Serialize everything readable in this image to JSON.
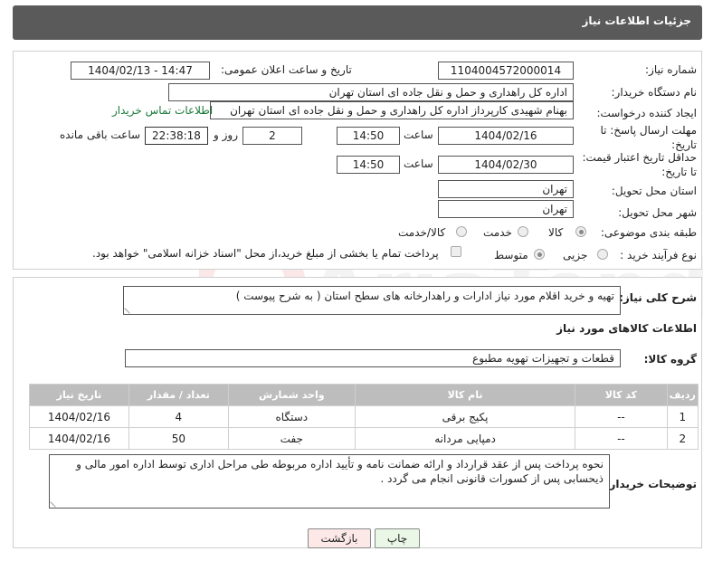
{
  "header": {
    "title": "جزئیات اطلاعات نیاز"
  },
  "fields": {
    "need_number_label": "شماره نیاز:",
    "need_number": "1104004572000014",
    "announce_label": "تاریخ و ساعت اعلان عمومی:",
    "announce_value": "1404/02/13 - 14:47",
    "buyer_org_label": "نام دستگاه خریدار:",
    "buyer_org": "اداره کل راهداری و حمل و نقل جاده ای استان تهران",
    "requester_label": "ایجاد کننده درخواست:",
    "requester": "بهنام شهیدی کارپرداز اداره کل راهداری و حمل و نقل جاده ای استان تهران",
    "buyer_contact_link": "اطلاعات تماس خریدار",
    "reply_deadline_label": "مهلت ارسال پاسخ: تا تاریخ:",
    "reply_date": "1404/02/16",
    "time_label": "ساعت",
    "reply_time": "14:50",
    "days_value": "2",
    "days_label": "روز و",
    "remaining_time": "22:38:18",
    "remaining_label": "ساعت باقی مانده",
    "price_validity_label": "حداقل تاریخ اعتبار قیمت: تا تاریخ:",
    "price_date": "1404/02/30",
    "price_time": "14:50",
    "province_label": "استان محل تحویل:",
    "province": "تهران",
    "city_label": "شهر محل تحویل:",
    "city": "تهران",
    "category_label": "طبقه بندی موضوعی:",
    "category_options": [
      "کالا",
      "خدمت",
      "کالا/خدمت"
    ],
    "process_label": "نوع فرآیند خرید :",
    "process_options": [
      "جزیی",
      "متوسط"
    ],
    "payment_note": "پرداخت تمام یا بخشی از مبلغ خرید،از محل \"اسناد خزانه اسلامی\" خواهد بود."
  },
  "description": {
    "label": "شرح کلی نیاز:",
    "text": "تهیه و خرید اقلام مورد نیاز ادارات و راهدارخانه های سطح استان ( به شرح پیوست )"
  },
  "goods": {
    "section_title": "اطلاعات کالاهای مورد نیاز",
    "group_label": "گروه کالا:",
    "group_value": "قطعات و تجهیزات تهویه مطبوع",
    "columns": [
      "ردیف",
      "کد کالا",
      "نام کالا",
      "واحد شمارش",
      "تعداد / مقدار",
      "تاریخ نیاز"
    ],
    "rows": [
      [
        "1",
        "--",
        "پکیج برقی",
        "دستگاه",
        "4",
        "1404/02/16"
      ],
      [
        "2",
        "--",
        "دمپایی مردانه",
        "جفت",
        "50",
        "1404/02/16"
      ]
    ]
  },
  "buyer_notes": {
    "label": "توضیحات خریدار:",
    "text": "نحوه پرداخت پس از عقد قرارداد و ارائه ضمانت نامه و تأیید اداره مربوطه طی مراحل اداری توسط اداره امور مالی و ذیحسابی پس از کسورات قانونی انجام می گردد ."
  },
  "buttons": {
    "print": "چاپ",
    "back": "بازگشت"
  },
  "colors": {
    "header_bg": "#5a5a5a",
    "table_header_bg": "#bdbdbd",
    "link": "#1a7a3a",
    "back_bg": "#fde8e8",
    "print_bg": "#eaf7e6"
  }
}
